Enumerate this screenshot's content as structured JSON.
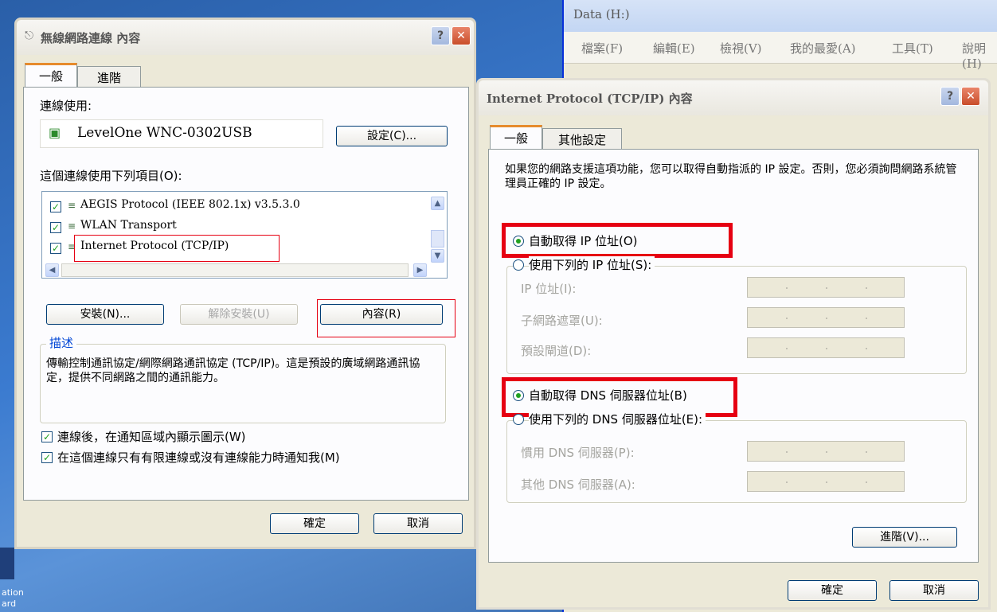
{
  "desktop": {
    "labels": [
      "ation",
      "ard"
    ]
  },
  "explorer": {
    "title": "Data (H:)",
    "menu": [
      "檔案(F)",
      "編輯(E)",
      "檢視(V)",
      "我的最愛(A)",
      "工具(T)",
      "說明(H)"
    ]
  },
  "wireless_dialog": {
    "title": "無線網路連線 內容",
    "tabs": [
      "一般",
      "進階"
    ],
    "connect_using_label": "連線使用:",
    "adapter_name": "LevelOne WNC-0302USB",
    "configure_button": "設定(C)...",
    "items_label": "這個連線使用下列項目(O):",
    "items": [
      {
        "label": "AEGIS Protocol (IEEE 802.1x) v3.5.3.0",
        "checked": true
      },
      {
        "label": "WLAN Transport",
        "checked": true
      },
      {
        "label": "Internet Protocol (TCP/IP)",
        "checked": true
      }
    ],
    "install_button": "安裝(N)...",
    "uninstall_button": "解除安裝(U)",
    "properties_button": "內容(R)",
    "description_title": "描述",
    "description_text": "傳輸控制通訊協定/網際網路通訊協定 (TCP/IP)。這是預設的廣域網路通訊協定，提供不同網路之間的通訊能力。",
    "show_icon_label": "連線後，在通知區域內顯示圖示(W)",
    "notify_label": "在這個連線只有有限連線或沒有連線能力時通知我(M)",
    "ok_button": "確定",
    "cancel_button": "取消"
  },
  "tcpip_dialog": {
    "title": "Internet Protocol (TCP/IP) 內容",
    "tabs": [
      "一般",
      "其他設定"
    ],
    "intro": "如果您的網路支援這項功能，您可以取得自動指派的 IP 設定。否則，您必須詢問網路系統管理員正確的 IP 設定。",
    "auto_ip_label": "自動取得 IP 位址(O)",
    "manual_ip_label": "使用下列的 IP 位址(S):",
    "ip_address_label": "IP 位址(I):",
    "subnet_label": "子網路遮罩(U):",
    "gateway_label": "預設閘道(D):",
    "auto_dns_label": "自動取得 DNS 伺服器位址(B)",
    "manual_dns_label": "使用下列的 DNS 伺服器位址(E):",
    "preferred_dns_label": "慣用 DNS 伺服器(P):",
    "alternate_dns_label": "其他 DNS 伺服器(A):",
    "advanced_button": "進階(V)...",
    "ok_button": "確定",
    "cancel_button": "取消"
  },
  "colors": {
    "highlight": "#e60012",
    "desktop": "#3a6ea5",
    "dialog_bg": "#ece9d8"
  }
}
